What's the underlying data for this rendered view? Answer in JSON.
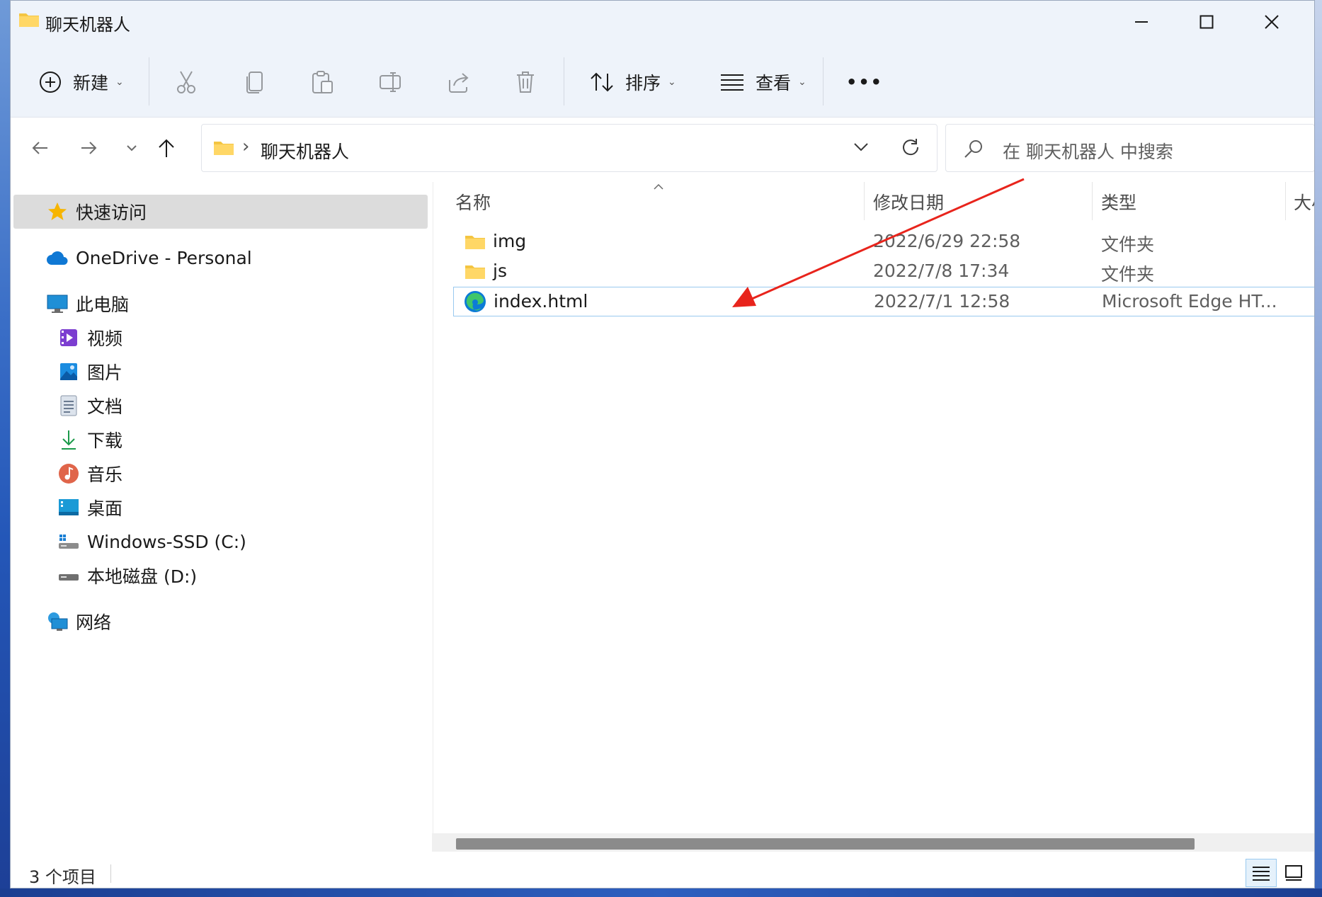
{
  "window": {
    "title": "聊天机器人",
    "icon": "folder-icon",
    "controls": [
      "minimize-icon",
      "maximize-icon",
      "close-icon"
    ]
  },
  "toolbar": {
    "new_label": "新建",
    "sort_label": "排序",
    "view_label": "查看",
    "more_label": "•••",
    "icons": [
      "add-icon",
      "cut-icon",
      "copy-icon",
      "paste-icon",
      "rename-icon",
      "share-icon",
      "delete-icon",
      "sort-icon",
      "view-icon"
    ]
  },
  "address": {
    "path": "聊天机器人",
    "separator": "›",
    "search_placeholder": "在 聊天机器人 中搜索"
  },
  "sidebar": {
    "quick_access": "快速访问",
    "onedrive": "OneDrive - Personal",
    "this_pc": "此电脑",
    "items": [
      {
        "label": "视频",
        "icon": "video-icon"
      },
      {
        "label": "图片",
        "icon": "pictures-icon"
      },
      {
        "label": "文档",
        "icon": "documents-icon"
      },
      {
        "label": "下载",
        "icon": "download-icon"
      },
      {
        "label": "音乐",
        "icon": "music-icon"
      },
      {
        "label": "桌面",
        "icon": "desktop-icon"
      },
      {
        "label": "Windows-SSD (C:)",
        "icon": "drive-c-icon"
      },
      {
        "label": "本地磁盘 (D:)",
        "icon": "drive-d-icon"
      }
    ],
    "network": "网络"
  },
  "columns": {
    "name": "名称",
    "modified": "修改日期",
    "type": "类型",
    "size": "大小"
  },
  "files": [
    {
      "name": "img",
      "modified": "2022/6/29 22:58",
      "type": "文件夹",
      "icon": "folder-icon"
    },
    {
      "name": "js",
      "modified": "2022/7/8 17:34",
      "type": "文件夹",
      "icon": "folder-icon"
    },
    {
      "name": "index.html",
      "modified": "2022/7/1 12:58",
      "type": "Microsoft Edge HT...",
      "icon": "edge-icon"
    }
  ],
  "status": {
    "item_count": "3 个项目"
  },
  "colors": {
    "accent": "#0067c0",
    "selection_border": "#99c9ef",
    "annotation_arrow": "#e8241c",
    "folder": "#f4c542"
  }
}
